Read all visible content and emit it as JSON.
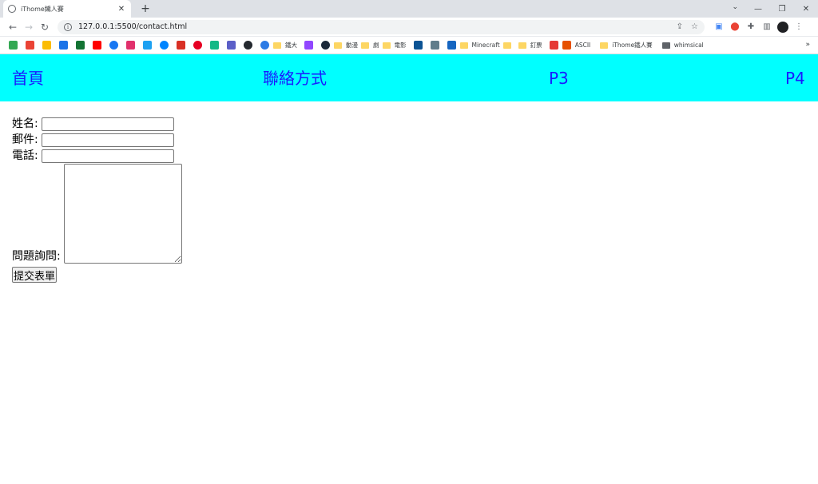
{
  "browser": {
    "tab_title": "iThome鐵人賽",
    "url": "127.0.0.1:5500/contact.html",
    "bookmarks": [
      "鐵大",
      "動漫",
      "劇",
      "電影",
      "Minecraft",
      "釘票",
      "ASCII",
      "iThome鐵人賽",
      "whimsical"
    ]
  },
  "site_nav": {
    "home": "首頁",
    "contact": "聯絡方式",
    "p3": "P3",
    "p4": "P4"
  },
  "form": {
    "name_label": "姓名:",
    "email_label": "郵件:",
    "phone_label": "電話:",
    "question_label": "問題詢問:",
    "submit_label": "提交表單"
  },
  "colors": {
    "nav_bg": "#00ffff",
    "nav_link": "#1a1aff"
  }
}
